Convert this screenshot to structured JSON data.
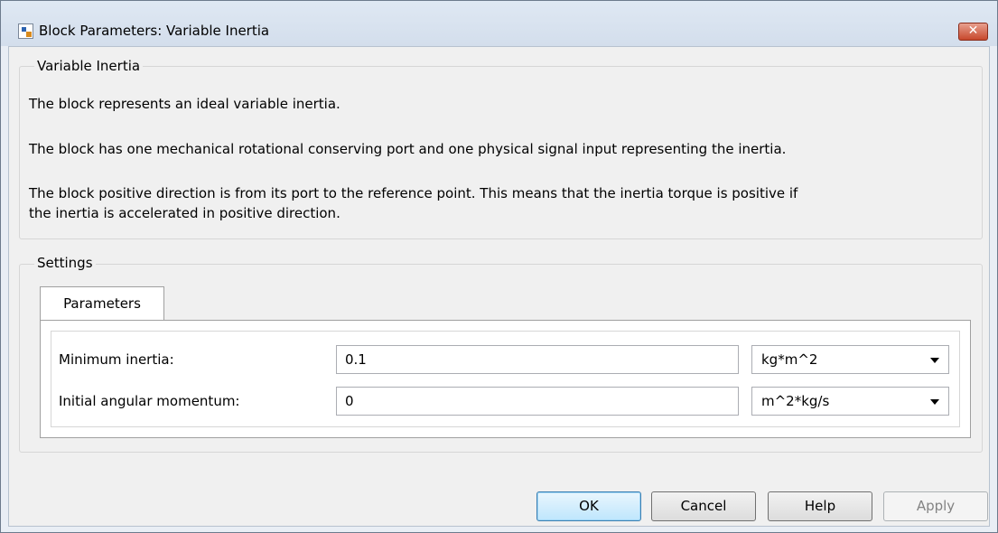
{
  "window": {
    "title": "Block Parameters: Variable Inertia",
    "close_symbol": "✕"
  },
  "description": {
    "group_title": "Variable Inertia",
    "line1": "The block represents an ideal variable inertia.",
    "line2": "The block has one mechanical rotational conserving port and one physical signal input representing the inertia.",
    "line3a": "The block positive direction is from its port to the reference point. This means that the inertia torque is positive if",
    "line3b": "the inertia is accelerated in positive direction."
  },
  "settings": {
    "group_title": "Settings",
    "tab_label": "Parameters",
    "params": [
      {
        "label": "Minimum inertia:",
        "value": "0.1",
        "unit": "kg*m^2"
      },
      {
        "label": "Initial angular momentum:",
        "value": "0",
        "unit": "m^2*kg/s"
      }
    ]
  },
  "buttons": {
    "ok": "OK",
    "cancel": "Cancel",
    "help": "Help",
    "apply": "Apply"
  },
  "colors": {
    "title_bar": "#d3deec",
    "close_button": "#c7482c",
    "default_button_border": "#3c7fb1"
  }
}
